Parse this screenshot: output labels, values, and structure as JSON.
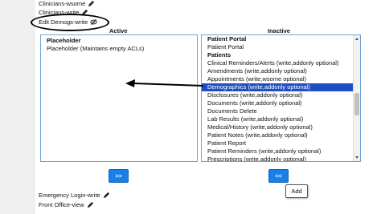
{
  "top_items": [
    {
      "label": "Clinicians-wsome"
    },
    {
      "label": "Clinicians-write"
    },
    {
      "label": "Edit Demogs-write"
    }
  ],
  "headings": {
    "active": "Active",
    "inactive": "Inactive"
  },
  "active_list": [
    {
      "label": "Placeholder",
      "group": true
    },
    {
      "label": "Placeholder (Maintains empty ACLs)",
      "group": false
    }
  ],
  "inactive_list": [
    {
      "label": "Patient Portal",
      "group": true
    },
    {
      "label": "Patient Portal",
      "group": false
    },
    {
      "label": "Patients",
      "group": true
    },
    {
      "label": "Clinical Reminders/Alerts (write,addonly optional)",
      "group": false
    },
    {
      "label": "Amendments (write,addonly optional)",
      "group": false
    },
    {
      "label": "Appointments (write,wsome optional)",
      "group": false
    },
    {
      "label": "Demographics (write,addonly optional)",
      "group": false,
      "selected": true
    },
    {
      "label": "Disclosures (write,addonly optional)",
      "group": false
    },
    {
      "label": "Documents (write,addonly optional)",
      "group": false
    },
    {
      "label": "Documents Delete",
      "group": false
    },
    {
      "label": "Lab Results (write,addonly optional)",
      "group": false
    },
    {
      "label": "Medical/History (write,addonly optional)",
      "group": false
    },
    {
      "label": "Patient Notes (write,addonly optional)",
      "group": false
    },
    {
      "label": "Patient Report",
      "group": false
    },
    {
      "label": "Patient Reminders (write,addonly optional)",
      "group": false
    },
    {
      "label": "Prescriptions (write,addonly optional)",
      "group": false
    }
  ],
  "buttons": {
    "move_right": ">>",
    "move_left": "<<"
  },
  "tooltip": "Add",
  "bottom_items": [
    {
      "label": "Emergency Login-write"
    },
    {
      "label": "Front Office-view"
    }
  ],
  "colors": {
    "button": "#1a80e8",
    "selection": "#1e4fc2",
    "listbox_border": "#6fa3d6"
  }
}
